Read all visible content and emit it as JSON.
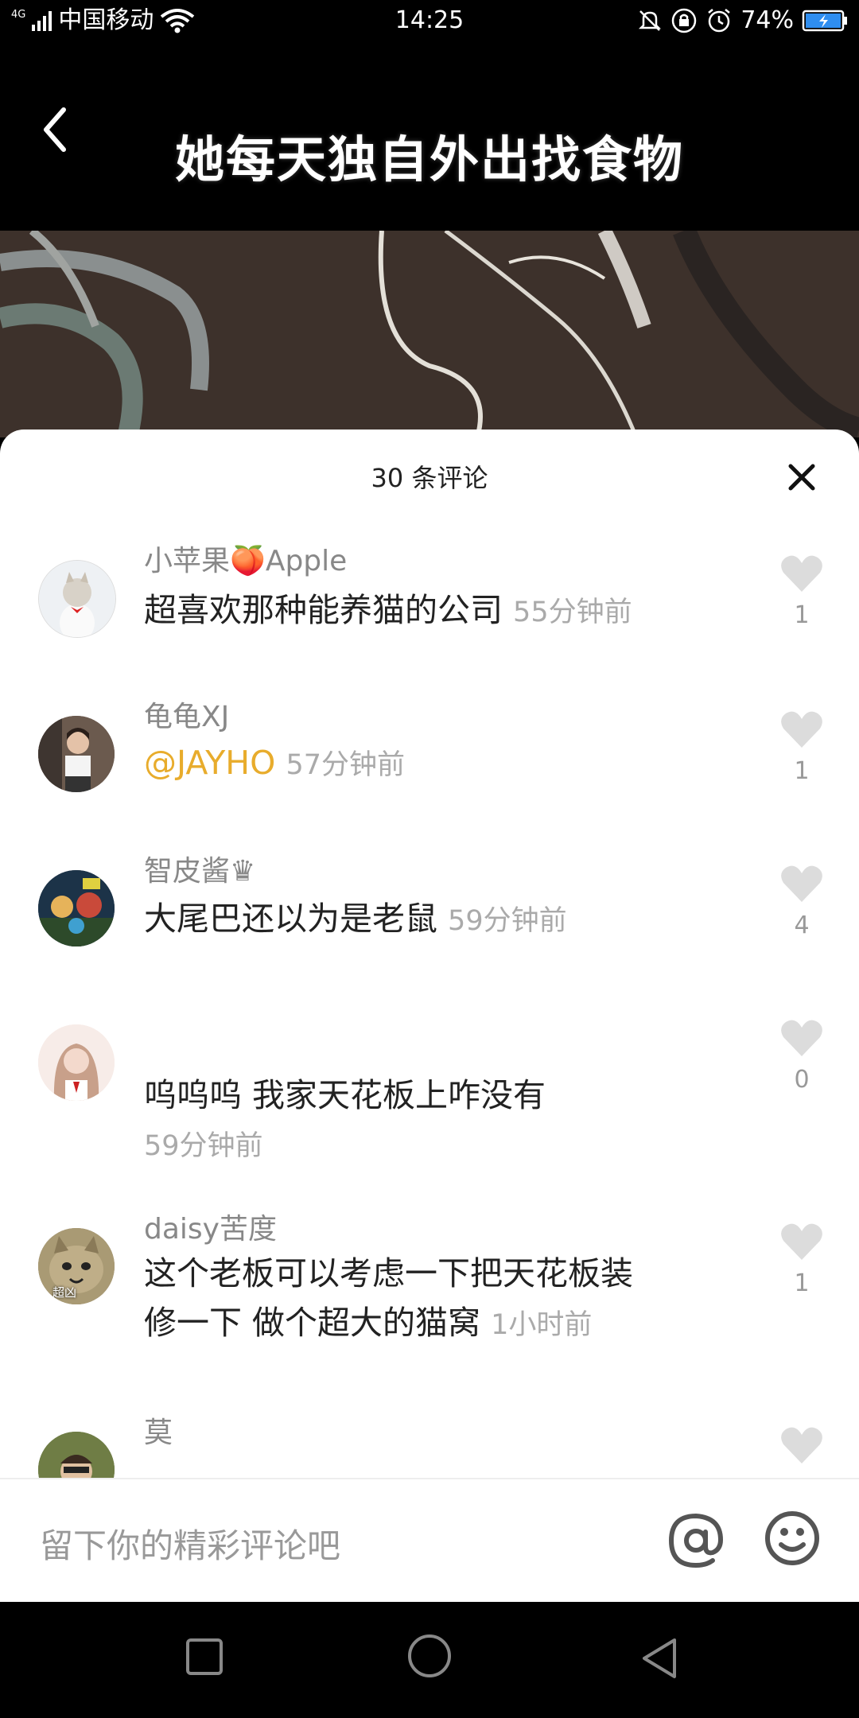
{
  "status_bar": {
    "network": "4G",
    "carrier": "中国移动",
    "time": "14:25",
    "battery": "74%"
  },
  "video": {
    "title": "她每天独自外出找食物"
  },
  "comments_panel": {
    "title": "30 条评论",
    "comments": [
      {
        "username": "小苹果🍑Apple",
        "text": "超喜欢那种能养猫的公司",
        "time": "55分钟前",
        "likes": "1"
      },
      {
        "username": "龟龟XJ",
        "mention": "@JAYHO",
        "text": "",
        "time": "57分钟前",
        "likes": "1"
      },
      {
        "username": "智皮酱♛",
        "text": "大尾巴还以为是老鼠",
        "time": "59分钟前",
        "likes": "4"
      },
      {
        "username": "",
        "text": "呜呜呜 我家天花板上咋没有",
        "time": "59分钟前",
        "likes": "0"
      },
      {
        "username": "daisy苦度",
        "avatar_badge": "超凶",
        "text_line1": "这个老板可以考虑一下把天花板装",
        "text_line2": "修一下 做个超大的猫窝",
        "time": "1小时前",
        "likes": "1"
      },
      {
        "username": "莫"
      }
    ]
  },
  "input": {
    "placeholder": "留下你的精彩评论吧"
  },
  "colors": {
    "mention": "#e8ac2c",
    "like_icon": "#dcdcdc",
    "muted_text": "#aaaaaa"
  }
}
